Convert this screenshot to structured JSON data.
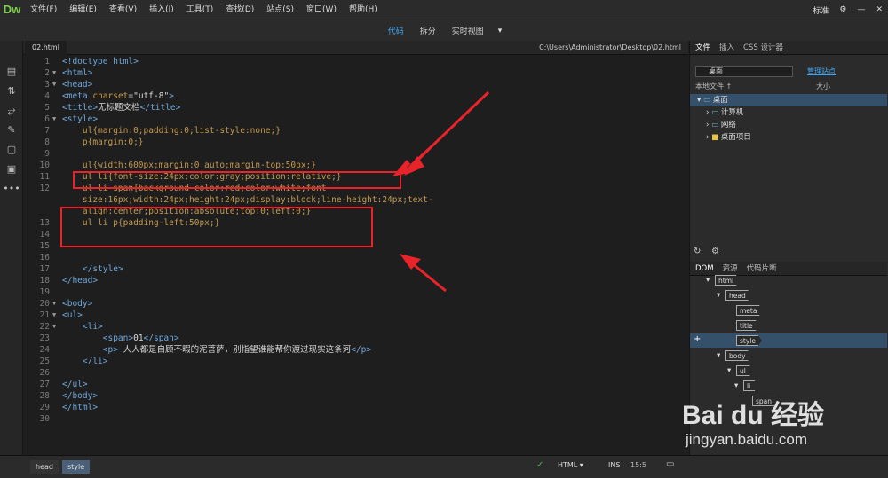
{
  "app": {
    "logo": "Dw"
  },
  "menu": [
    "文件(F)",
    "编辑(E)",
    "查看(V)",
    "插入(I)",
    "工具(T)",
    "查找(D)",
    "站点(S)",
    "窗口(W)",
    "帮助(H)"
  ],
  "menu_right": {
    "workspace": "标准",
    "settings": "⚙",
    "minimize": "—",
    "close": "✕"
  },
  "views": [
    "代码",
    "拆分",
    "实时视图"
  ],
  "document": {
    "tab": "02.html",
    "path": "C:\\Users\\Administrator\\Desktop\\02.html"
  },
  "code_lines": [
    {
      "n": "1",
      "f": "",
      "h": "<span class='t'>&lt;!doctype html&gt;</span>"
    },
    {
      "n": "2",
      "f": "▼",
      "h": "<span class='t'>&lt;html&gt;</span>"
    },
    {
      "n": "3",
      "f": "▼",
      "h": "<span class='t'>&lt;head&gt;</span>"
    },
    {
      "n": "4",
      "f": "",
      "h": "<span class='t'>&lt;meta</span> <span class='css'>charset</span><span class='c'>=</span><span class='s'>\"utf-8\"</span><span class='t'>&gt;</span>"
    },
    {
      "n": "5",
      "f": "",
      "h": "<span class='t'>&lt;title&gt;</span><span class='txt'>无标题文档</span><span class='t'>&lt;/title&gt;</span>"
    },
    {
      "n": "6",
      "f": "▼",
      "h": "<span class='t'>&lt;style&gt;</span>"
    },
    {
      "n": "7",
      "f": "",
      "h": "    <span class='css'>ul{margin:0;padding:0;list-style:none;}</span>"
    },
    {
      "n": "8",
      "f": "",
      "h": "    <span class='css'>p{margin:0;}</span>"
    },
    {
      "n": "9",
      "f": "",
      "h": ""
    },
    {
      "n": "10",
      "f": "",
      "h": "    <span class='css'>ul{width:600px;margin:0 auto;margin-top:50px;}</span>"
    },
    {
      "n": "11",
      "f": "",
      "h": "    <span class='css'>ul li{font-size:24px;color:gray;position:relative;}</span>"
    },
    {
      "n": "12",
      "f": "",
      "h": "    <span class='css'>ul li span{background-color:red;color:white;font-</span>"
    },
    {
      "n": "",
      "f": "",
      "h": "    <span class='css'>size:16px;width:24px;height:24px;display:block;line-height:24px;text-</span>"
    },
    {
      "n": "",
      "f": "",
      "h": "    <span class='css'>align:center;position:absolute;top:0;left:0;}</span>"
    },
    {
      "n": "13",
      "f": "",
      "h": "    <span class='css'>ul li p{padding-left:50px;}</span>"
    },
    {
      "n": "14",
      "f": "",
      "h": ""
    },
    {
      "n": "15",
      "f": "",
      "h": ""
    },
    {
      "n": "16",
      "f": "",
      "h": ""
    },
    {
      "n": "17",
      "f": "",
      "h": "    <span class='t'>&lt;/style&gt;</span>"
    },
    {
      "n": "18",
      "f": "",
      "h": "<span class='t'>&lt;/head&gt;</span>"
    },
    {
      "n": "19",
      "f": "",
      "h": ""
    },
    {
      "n": "20",
      "f": "▼",
      "h": "<span class='t'>&lt;body&gt;</span>"
    },
    {
      "n": "21",
      "f": "▼",
      "h": "<span class='t'>&lt;ul&gt;</span>"
    },
    {
      "n": "22",
      "f": "▼",
      "h": "    <span class='t'>&lt;li&gt;</span>"
    },
    {
      "n": "23",
      "f": "",
      "h": "        <span class='t'>&lt;span&gt;</span><span class='txt'>01</span><span class='t'>&lt;/span&gt;</span>"
    },
    {
      "n": "24",
      "f": "",
      "h": "        <span class='t'>&lt;p&gt;</span> <span class='txt'>人人都是自顾不暇的泥菩萨，别指望谁能帮你渡过现实这条河</span><span class='t'>&lt;/p&gt;</span>"
    },
    {
      "n": "25",
      "f": "",
      "h": "    <span class='t'>&lt;/li&gt;</span>"
    },
    {
      "n": "26",
      "f": "",
      "h": ""
    },
    {
      "n": "27",
      "f": "",
      "h": "<span class='t'>&lt;/ul&gt;</span>"
    },
    {
      "n": "28",
      "f": "",
      "h": "<span class='t'>&lt;/body&gt;</span>"
    },
    {
      "n": "29",
      "f": "",
      "h": "<span class='t'>&lt;/html&gt;</span>"
    },
    {
      "n": "30",
      "f": "",
      "h": ""
    }
  ],
  "status": {
    "crumbs": [
      "head",
      "style"
    ],
    "language": "HTML",
    "mode": "INS",
    "position": "15:5"
  },
  "files_panel": {
    "tabs": [
      "文件",
      "插入",
      "CSS 设计器"
    ],
    "site": "桌面",
    "manage": "管理站点",
    "col_local": "本地文件 ↑",
    "col_size": "大小",
    "root": "桌面",
    "items": [
      "计算机",
      "网络",
      "桌面项目"
    ]
  },
  "dom_panel": {
    "tabs": [
      "DOM",
      "资源",
      "代码片断"
    ],
    "nodes": [
      "html",
      "head",
      "meta",
      "title",
      "style",
      "body",
      "ul",
      "li",
      "span"
    ]
  },
  "watermark": {
    "brand": "Bai du 经验",
    "url": "jingyan.baidu.com"
  }
}
